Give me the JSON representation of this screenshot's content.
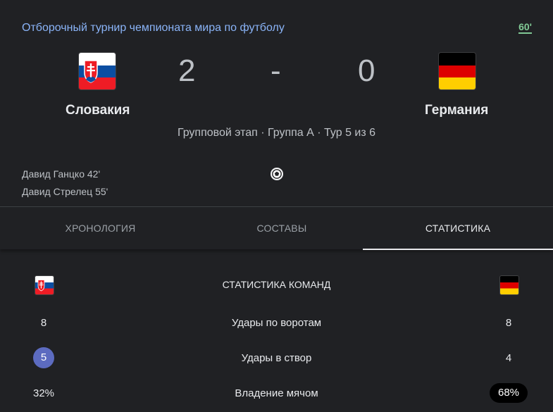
{
  "match": {
    "tournament": "Отборочный турнир чемпионата мира по футболу",
    "live_minute": "60'",
    "stage": "Групповой этап · Группа А · Тур 5 из 6",
    "home": {
      "name": "Словакия",
      "score": "2",
      "flag": "slovakia-flag"
    },
    "away": {
      "name": "Германия",
      "score": "0",
      "flag": "germany-flag"
    },
    "separator": "-",
    "goals_home": [
      "Давид Ганцко 42'",
      "Давид Стрелец 55'"
    ]
  },
  "tabs": [
    {
      "label": "ХРОНОЛОГИЯ",
      "active": false
    },
    {
      "label": "СОСТАВЫ",
      "active": false
    },
    {
      "label": "СТАТИСТИКА",
      "active": true
    }
  ],
  "stats": {
    "title": "СТАТИСТИКА КОМАНД",
    "rows": [
      {
        "label": "Удары по воротам",
        "home": "8",
        "away": "8"
      },
      {
        "label": "Удары в створ",
        "home": "5",
        "away": "4"
      },
      {
        "label": "Владение мячом",
        "home": "32%",
        "away": "68%"
      }
    ]
  },
  "colors": {
    "background": "#202124",
    "link": "#8ab4f8",
    "live": "#81c995",
    "highlight_circle": "#5c6bc0",
    "highlight_pill": "#000000"
  }
}
